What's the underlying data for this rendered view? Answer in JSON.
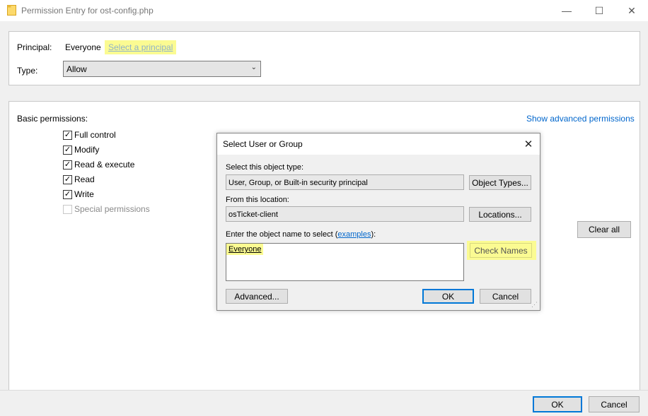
{
  "window": {
    "title": "Permission Entry for ost-config.php",
    "icon": "folder-icon",
    "minimize": "—",
    "maximize": "☐",
    "close": "✕"
  },
  "principal": {
    "label": "Principal:",
    "value": "Everyone",
    "link": "Select a principal"
  },
  "type": {
    "label": "Type:",
    "value": "Allow"
  },
  "permissions": {
    "label": "Basic permissions:",
    "advanced_link": "Show advanced permissions",
    "items": [
      {
        "label": "Full control",
        "checked": true,
        "enabled": true
      },
      {
        "label": "Modify",
        "checked": true,
        "enabled": true
      },
      {
        "label": "Read & execute",
        "checked": true,
        "enabled": true
      },
      {
        "label": "Read",
        "checked": true,
        "enabled": true
      },
      {
        "label": "Write",
        "checked": true,
        "enabled": true
      },
      {
        "label": "Special permissions",
        "checked": false,
        "enabled": false
      }
    ],
    "clear_all": "Clear all"
  },
  "dialog": {
    "title": "Select User or Group",
    "object_type_label": "Select this object type:",
    "object_type_value": "User, Group, or Built-in security principal",
    "object_types_button": "Object Types...",
    "location_label": "From this location:",
    "location_value": "osTicket-client",
    "locations_button": "Locations...",
    "name_label_prefix": "Enter the object name to select (",
    "name_label_link": "examples",
    "name_label_suffix": "):",
    "name_value": "Everyone",
    "check_names_button": "Check Names",
    "advanced_button": "Advanced...",
    "ok_button": "OK",
    "cancel_button": "Cancel"
  },
  "footer": {
    "ok": "OK",
    "cancel": "Cancel"
  },
  "colors": {
    "highlight": "#fbfb92",
    "link": "#0066cc",
    "default_button_border": "#0078d7"
  }
}
